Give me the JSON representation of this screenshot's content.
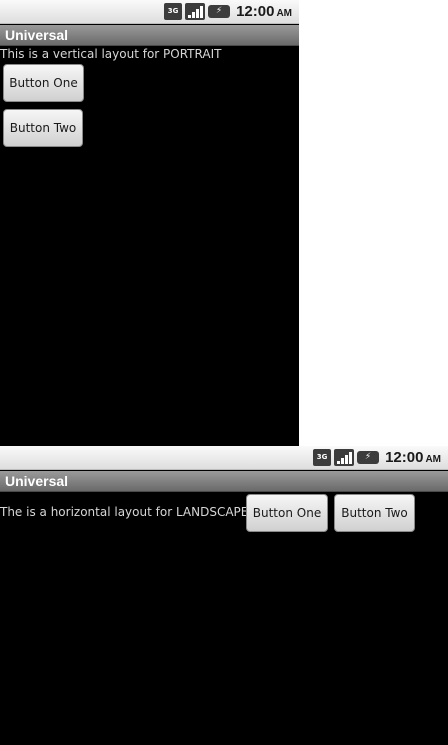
{
  "status_bar": {
    "network_label": "3G",
    "time": "12:00",
    "ampm": "AM"
  },
  "app": {
    "title": "Universal"
  },
  "portrait": {
    "message": "This is a vertical layout for PORTRAIT",
    "button_one": "Button One",
    "button_two": "Button Two"
  },
  "landscape": {
    "message": "The is a horizontal layout for LANDSCAPE",
    "button_one": "Button One",
    "button_two": "Button Two"
  }
}
